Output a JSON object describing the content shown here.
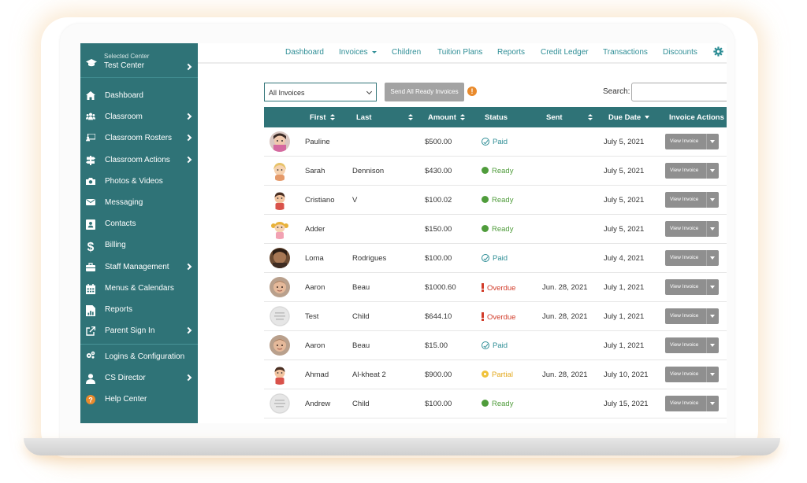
{
  "sidebar": {
    "selected_center_label": "Selected Center",
    "center_name": "Test Center",
    "items": [
      {
        "label": "Dashboard",
        "icon": "home-icon",
        "chevron": false
      },
      {
        "label": "Classroom",
        "icon": "users-icon",
        "chevron": true
      },
      {
        "label": "Classroom Rosters",
        "icon": "roster-icon",
        "chevron": true
      },
      {
        "label": "Classroom Actions",
        "icon": "signpost-icon",
        "chevron": true
      },
      {
        "label": "Photos & Videos",
        "icon": "camera-icon",
        "chevron": false
      },
      {
        "label": "Messaging",
        "icon": "envelope-icon",
        "chevron": false
      },
      {
        "label": "Contacts",
        "icon": "contact-card-icon",
        "chevron": false
      },
      {
        "label": "Billing",
        "icon": "dollar-icon",
        "chevron": false
      },
      {
        "label": "Staff Management",
        "icon": "briefcase-icon",
        "chevron": true
      },
      {
        "label": "Menus & Calendars",
        "icon": "calendar-icon",
        "chevron": false
      },
      {
        "label": "Reports",
        "icon": "report-icon",
        "chevron": false
      },
      {
        "label": "Parent Sign In",
        "icon": "external-link-icon",
        "chevron": true
      },
      {
        "label": "Logins & Configuration",
        "icon": "cogs-icon",
        "chevron": false
      },
      {
        "label": "CS Director",
        "icon": "user-icon",
        "chevron": true
      },
      {
        "label": "Help Center",
        "icon": "help-icon",
        "chevron": false
      }
    ]
  },
  "topnav": {
    "items": [
      "Dashboard",
      "Invoices",
      "Children",
      "Tuition Plans",
      "Reports",
      "Credit Ledger",
      "Transactions",
      "Discounts"
    ],
    "settings_icon": "gear-icon"
  },
  "toolbar": {
    "filter_value": "All Invoices",
    "send_button": "Send All Ready Invoices",
    "info_glyph": "!",
    "search_label": "Search:"
  },
  "table": {
    "headers": {
      "first": "First",
      "last": "Last",
      "amount": "Amount",
      "status": "Status",
      "sent": "Sent",
      "due_date": "Due Date",
      "actions": "Invoice Actions"
    },
    "action_label": "View Invoice",
    "rows": [
      {
        "first": "Pauline",
        "last": "",
        "amount": "$500.00",
        "status": "Paid",
        "status_type": "paid",
        "sent": "",
        "due": "July 5, 2021",
        "avatar": "photo-girl"
      },
      {
        "first": "Sarah",
        "last": "Dennison",
        "amount": "$430.00",
        "status": "Ready",
        "status_type": "ready",
        "sent": "",
        "due": "July 5, 2021",
        "avatar": "cartoon-blonde"
      },
      {
        "first": "Cristiano",
        "last": "V",
        "amount": "$100.02",
        "status": "Ready",
        "status_type": "ready",
        "sent": "",
        "due": "July 5, 2021",
        "avatar": "cartoon-boy"
      },
      {
        "first": "Adder",
        "last": "",
        "amount": "$150.00",
        "status": "Ready",
        "status_type": "ready",
        "sent": "",
        "due": "July 5, 2021",
        "avatar": "cartoon-pigtails"
      },
      {
        "first": "Loma",
        "last": "Rodrigues",
        "amount": "$100.00",
        "status": "Paid",
        "status_type": "paid",
        "sent": "",
        "due": "July 4, 2021",
        "avatar": "photo-dark"
      },
      {
        "first": "Aaron",
        "last": "Beau",
        "amount": "$1000.60",
        "status": "Overdue",
        "status_type": "overdue",
        "sent": "Jun. 28, 2021",
        "due": "July 1, 2021",
        "avatar": "photo-baby"
      },
      {
        "first": "Test",
        "last": "Child",
        "amount": "$644.10",
        "status": "Overdue",
        "status_type": "overdue",
        "sent": "Jun. 28, 2021",
        "due": "July 1, 2021",
        "avatar": "placeholder"
      },
      {
        "first": "Aaron",
        "last": "Beau",
        "amount": "$15.00",
        "status": "Paid",
        "status_type": "paid",
        "sent": "",
        "due": "July 1, 2021",
        "avatar": "photo-baby"
      },
      {
        "first": "Ahmad",
        "last": "Al-kheat 2",
        "amount": "$900.00",
        "status": "Partial",
        "status_type": "partial",
        "sent": "Jun. 28, 2021",
        "due": "July 10, 2021",
        "avatar": "cartoon-boy"
      },
      {
        "first": "Andrew",
        "last": "Child",
        "amount": "$100.00",
        "status": "Ready",
        "status_type": "ready",
        "sent": "",
        "due": "July 15, 2021",
        "avatar": "placeholder"
      }
    ]
  },
  "colors": {
    "primary": "#2f7377",
    "link": "#2f8e96",
    "ready": "#4f9c3b",
    "overdue": "#d23c2a",
    "partial": "#e3a81c",
    "button_gray": "#8f8f8f",
    "info": "#e98a2c"
  }
}
